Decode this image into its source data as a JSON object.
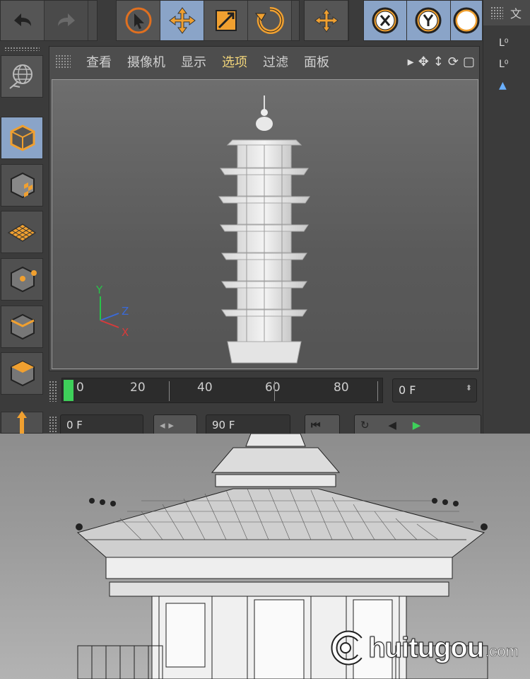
{
  "menu": {
    "items": [
      "查看",
      "摄像机",
      "显示",
      "选项",
      "过滤",
      "面板"
    ],
    "active_index": 3
  },
  "viewport": {
    "axis": {
      "y": "Y",
      "z": "Z",
      "x": "X"
    }
  },
  "timeline": {
    "ticks": [
      "0",
      "20",
      "40",
      "60",
      "80"
    ],
    "current_frame": "0 F"
  },
  "playback": {
    "start_frame": "0 F",
    "end_frame": "90 F"
  },
  "right_panel": {
    "header_label": "文"
  },
  "watermark": {
    "text": "huitugou",
    "suffix": ".com"
  },
  "colors": {
    "accent_active": "#8aa4c8",
    "orange": "#f0a030",
    "menu_active": "#f2d57a"
  }
}
